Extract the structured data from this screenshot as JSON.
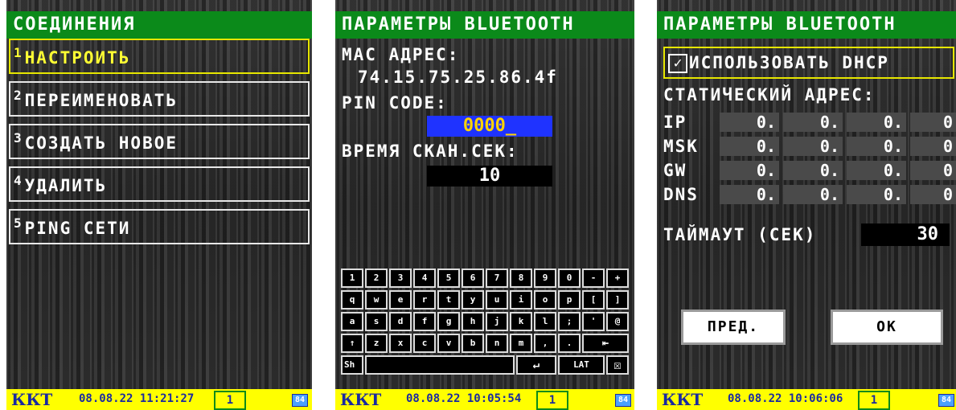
{
  "screen1": {
    "title": "СОЕДИНЕНИЯ",
    "items": [
      {
        "num": "1",
        "label": "НАСТРОИТЬ"
      },
      {
        "num": "2",
        "label": "ПЕРЕИМЕНОВАТЬ"
      },
      {
        "num": "3",
        "label": "СОЗДАТЬ НОВОЕ"
      },
      {
        "num": "4",
        "label": "УДАЛИТЬ"
      },
      {
        "num": "5",
        "label": "PING СЕТИ"
      }
    ],
    "status": {
      "kkt": "ККТ",
      "datetime": "08.08.22 11:21:27",
      "num": "1",
      "battery": "84"
    }
  },
  "screen2": {
    "title": "ПАРАМЕТРЫ BLUETOOTH",
    "mac_label": "MAC АДРЕС:",
    "mac_value": "74.15.75.25.86.4f",
    "pin_label": "PIN CODE:",
    "pin_value": "0000_",
    "scan_label": "ВРЕМЯ СКАН.СЕК:",
    "scan_value": "10",
    "keyboard": {
      "row1": [
        "1",
        "2",
        "3",
        "4",
        "5",
        "6",
        "7",
        "8",
        "9",
        "0",
        "-",
        "+"
      ],
      "row2": [
        "q",
        "w",
        "e",
        "r",
        "t",
        "y",
        "u",
        "i",
        "o",
        "p",
        "[",
        "]"
      ],
      "row3": [
        "a",
        "s",
        "d",
        "f",
        "g",
        "h",
        "j",
        "k",
        "l",
        ";",
        "'",
        "@"
      ],
      "row4": [
        "↑",
        "z",
        "x",
        "c",
        "v",
        "b",
        "n",
        "m",
        ",",
        "."
      ],
      "backspace": "⇤",
      "shift": "Sh",
      "enter": "↵",
      "lang": "LAT",
      "close": "☒"
    },
    "status": {
      "kkt": "ККТ",
      "datetime": "08.08.22 10:05:54",
      "num": "1",
      "battery": "84"
    }
  },
  "screen3": {
    "title": "ПАРАМЕТРЫ BLUETOOTH",
    "checkbox_glyph": "✓",
    "dhcp_label": "ИСПОЛЬЗОВАТЬ DHCP",
    "static_label": "СТАТИЧЕСКИЙ АДРЕС:",
    "rows": [
      {
        "label": "IP",
        "octets": [
          "0.",
          "0.",
          "0.",
          "0"
        ]
      },
      {
        "label": "MSK",
        "octets": [
          "0.",
          "0.",
          "0.",
          "0"
        ]
      },
      {
        "label": "GW",
        "octets": [
          "0.",
          "0.",
          "0.",
          "0"
        ]
      },
      {
        "label": "DNS",
        "octets": [
          "0.",
          "0.",
          "0.",
          "0"
        ]
      }
    ],
    "timeout_label": "ТАЙМАУТ (СЕК)",
    "timeout_value": "30",
    "prev_button": "ПРЕД.",
    "ok_button": "OK",
    "status": {
      "kkt": "ККТ",
      "datetime": "08.08.22 10:06:06",
      "num": "1",
      "battery": "84"
    }
  },
  "colors": {
    "title_bg": "#0b8a1a",
    "status_bg": "#ffff00",
    "active": "#e6e600",
    "pin_bg": "#1f33ff",
    "pin_text": "#ffd400"
  }
}
